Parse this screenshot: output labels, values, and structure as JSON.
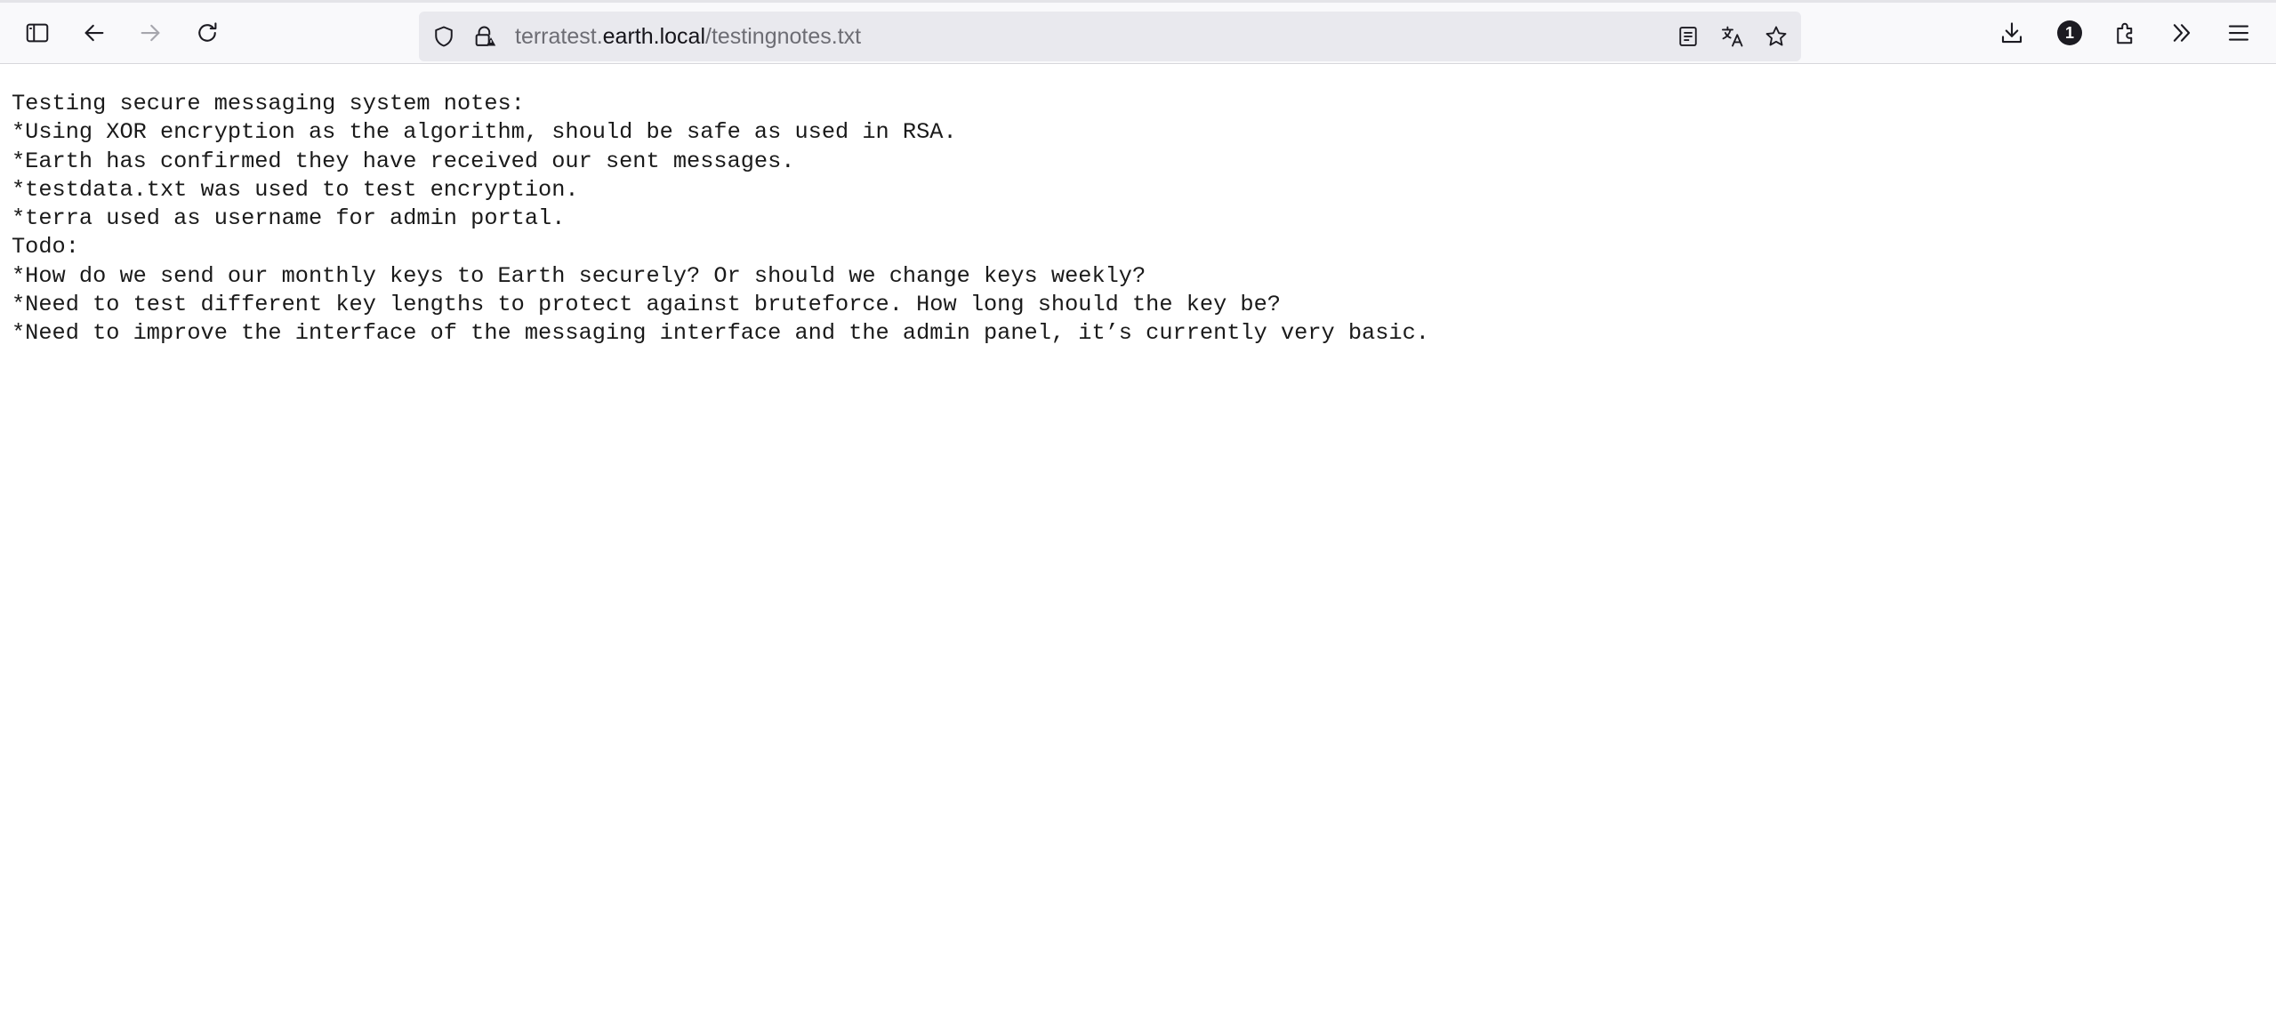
{
  "browser": {
    "url": {
      "prefix": "terratest.",
      "domain": "earth.local",
      "path": "/testingnotes.txt"
    },
    "extensions_badge": "1",
    "icons": {
      "sidebar": "sidebar-icon",
      "back": "back-arrow-icon",
      "forward": "forward-arrow-icon",
      "reload": "reload-icon",
      "tracking_protection": "shield-icon",
      "connection": "lock-warning-icon",
      "reader_view": "reader-view-icon",
      "translate": "translate-icon",
      "bookmark": "star-icon",
      "downloads": "download-icon",
      "extensions": "puzzle-icon",
      "overflow": "chevron-double-right-icon",
      "menu": "hamburger-menu-icon"
    }
  },
  "document": {
    "lines": [
      "Testing secure messaging system notes:",
      "*Using XOR encryption as the algorithm, should be safe as used in RSA.",
      "*Earth has confirmed they have received our sent messages.",
      "*testdata.txt was used to test encryption.",
      "*terra used as username for admin portal.",
      "Todo:",
      "*How do we send our monthly keys to Earth securely? Or should we change keys weekly?",
      "*Need to test different key lengths to protect against bruteforce. How long should the key be?",
      "*Need to improve the interface of the messaging interface and the admin panel, it’s currently very basic."
    ]
  }
}
